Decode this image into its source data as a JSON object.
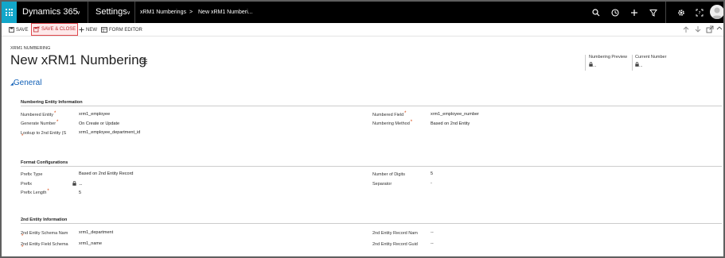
{
  "nav": {
    "app_name": "Dynamics 365",
    "area": "Settings",
    "entity": "xRM1 Numberings",
    "record": "New xRM1 Numberi..."
  },
  "toolbar": {
    "save": "SAVE",
    "save_close": "SAVE & CLOSE",
    "new": "NEW",
    "form_editor": "FORM EDITOR"
  },
  "header": {
    "record_type": "XRM1 NUMBERING",
    "title": "New xRM1 Numbering",
    "fields": [
      {
        "label": "Numbering Preview",
        "value": "..."
      },
      {
        "label": "Current Number",
        "value": "..."
      }
    ]
  },
  "section": {
    "title": "General"
  },
  "numbering_entity": {
    "heading": "Numbering Entity Information",
    "left": [
      {
        "label": "Numbered Entity",
        "value": "xrm1_employee"
      },
      {
        "label": "Generate Number",
        "value": "On Create or Update"
      },
      {
        "label": "Lookup to 2nd Entity (S",
        "value": "xrm1_employee_department_id"
      }
    ],
    "right": [
      {
        "label": "Numbered Field",
        "value": "xrm1_employee_number"
      },
      {
        "label": "Numbering Method",
        "value": "Based on 2nd Entity"
      }
    ]
  },
  "format": {
    "heading": "Format Configurations",
    "left": [
      {
        "label": "Prefix Type",
        "value": "Based on 2nd Entity Record"
      },
      {
        "label": "Prefix",
        "value": "--"
      },
      {
        "label": "Prefix Length",
        "value": "5"
      }
    ],
    "right": [
      {
        "label": "Number of Digits",
        "value": "5"
      },
      {
        "label": "Separator",
        "value": "-"
      }
    ]
  },
  "second_entity": {
    "heading": "2nd Entity Information",
    "left": [
      {
        "label": "2nd Entity Schema Nam",
        "value": "xrm1_department"
      },
      {
        "label": "2nd Entity Field Schema",
        "value": "xrm1_name"
      }
    ],
    "right": [
      {
        "label": "2nd Entity Record Nam",
        "value": "--"
      },
      {
        "label": "2nd Entity Record Guid",
        "value": "--"
      }
    ]
  },
  "colors": {
    "nav_bg": "#000000",
    "waffle_bg": "#12a6c9",
    "accent_blue": "#1160b7",
    "required": "#d83b01",
    "highlight_border": "#e0474c"
  }
}
